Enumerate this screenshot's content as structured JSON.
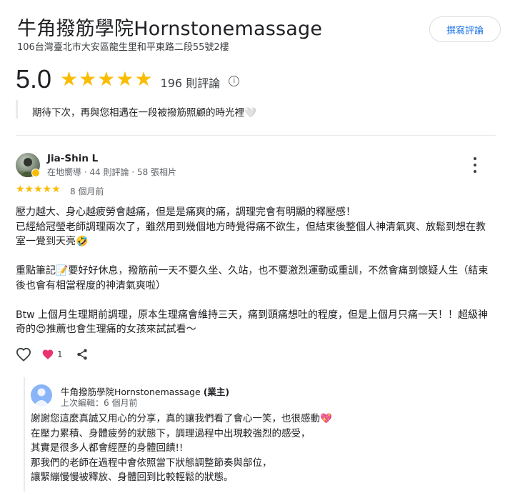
{
  "place": {
    "title": "牛角撥筋學院Hornstonemassage",
    "address": "106台灣臺北市大安區龍生里和平東路二段55號2樓",
    "write_review_label": "撰寫評論",
    "rating": "5.0",
    "rating_stars": "★★★★★",
    "review_count": "196 則評論",
    "info_icon_glyph": "i"
  },
  "truncated_reply": {
    "text": "期待下次，再與您相遇在一段被撥筋照顧的時光裡🤍"
  },
  "review": {
    "reviewer_name": "Jia-Shin L",
    "reviewer_meta": "在地嚮導 · 44 則評論 · 58 張相片",
    "stars": "★★★★★",
    "date": "8 個月前",
    "paragraphs": [
      "壓力越大、身心越疲勞會越痛，但是是痛爽的痛，調理完會有明顯的釋壓感！",
      "已經給冠瑩老師調理兩次了，雖然用到幾個地方時覺得痛不欲生，但結束後整個人神清氣爽、放鬆到想在教室一覺到天亮🤣",
      "重點筆記📝要好好休息，撥筋前一天不要久坐、久站，也不要激烈運動或重訓，不然會痛到懷疑人生（結束後也會有相當程度的神清氣爽啦）",
      "Btw 上個月生理期前調理，原本生理痛會維持三天，痛到頭痛想吐的程度，但是上個月只痛一天！！超級神奇的😍推薦也會生理痛的女孩來試試看〜"
    ],
    "heart_count": "1"
  },
  "owner_reply": {
    "name": "牛角撥筋學院Hornstonemassage",
    "owner_tag": "(業主)",
    "edited": "上次編輯：6 個月前",
    "lines": [
      "謝謝您這麼真誠又用心的分享，真的讓我們看了會心一笑，也很感動💖",
      "在壓力累積、身體疲勞的狀態下，調理過程中出現較強烈的感受，",
      "其實是很多人都會經歷的身體回饋!!",
      "那我們的老師在過程中會依照當下狀態調整節奏與部位，",
      "讓緊繃慢慢被釋放、身體回到比較輕鬆的狀態。"
    ]
  },
  "colors": {
    "star": "#fbbc04",
    "link_blue": "#1a73e8",
    "heart": "#e8336f",
    "owner_avatar": "#8ab4f8"
  },
  "icons": {
    "info": "info-icon",
    "more": "more-vert-icon",
    "like": "heart-outline-icon",
    "reaction": "heart-filled-icon",
    "share": "share-icon",
    "avatar": "person-icon"
  }
}
